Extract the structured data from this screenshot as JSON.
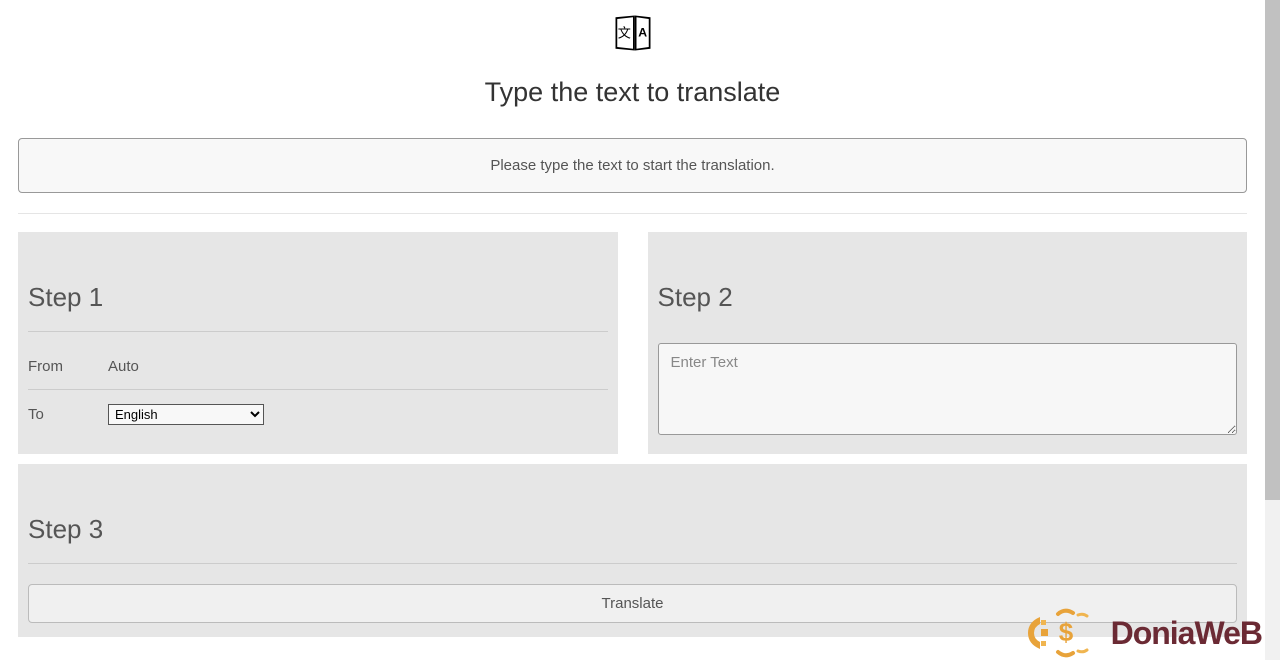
{
  "header": {
    "title": "Type the text to translate"
  },
  "notice": {
    "text": "Please type the text to start the translation."
  },
  "step1": {
    "heading": "Step 1",
    "from_label": "From",
    "from_value": "Auto",
    "to_label": "To",
    "to_selected": "English"
  },
  "step2": {
    "heading": "Step 2",
    "textarea_placeholder": "Enter Text"
  },
  "step3": {
    "heading": "Step 3",
    "button_label": "Translate"
  },
  "watermark": {
    "text": "DoniaWeB"
  }
}
